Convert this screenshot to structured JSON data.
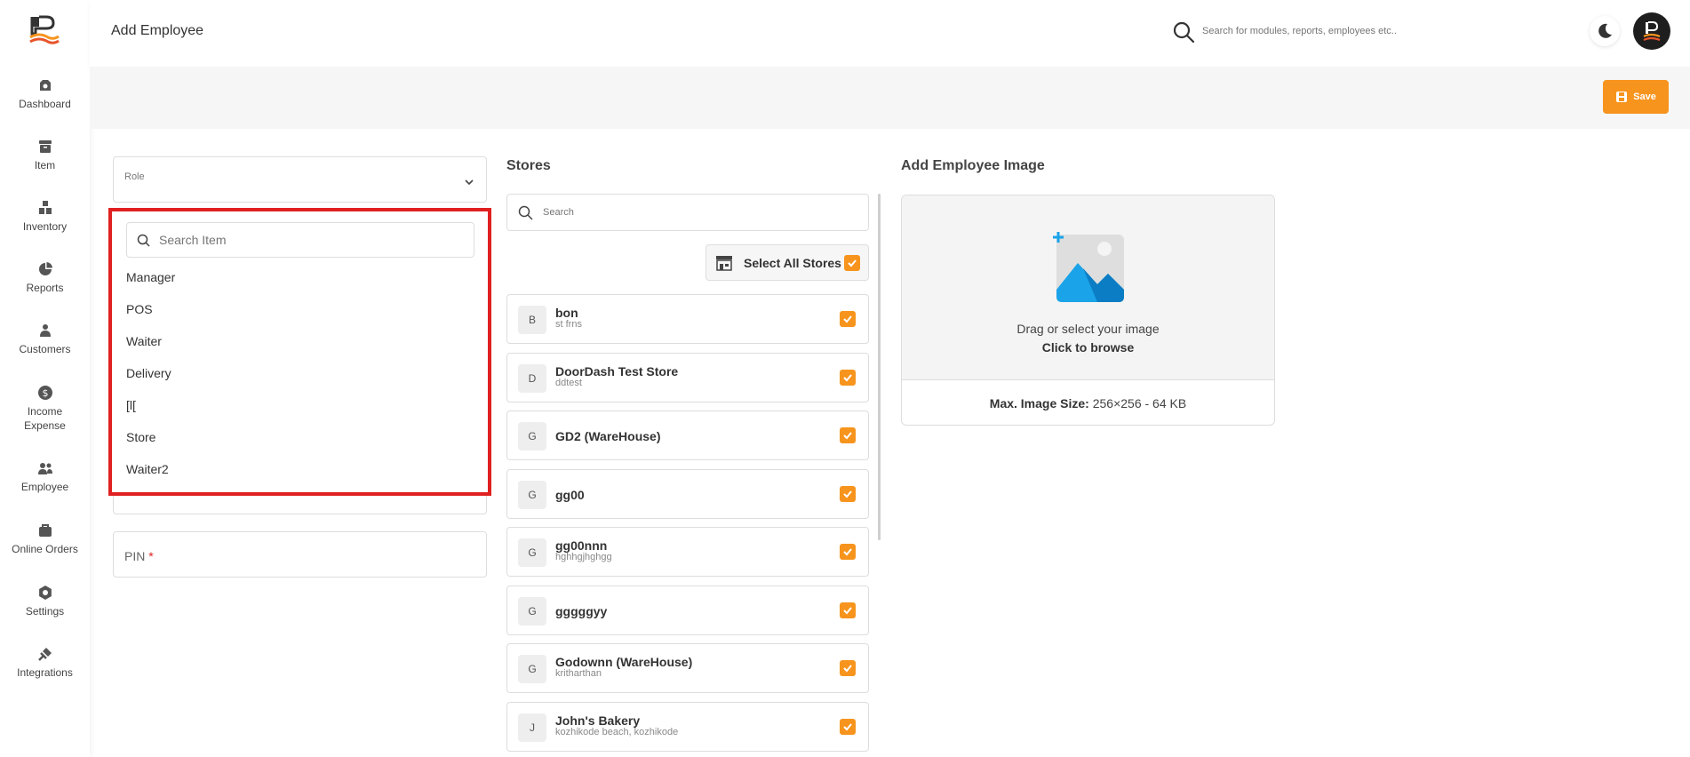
{
  "sidebar": {
    "items": [
      {
        "label": "Dashboard",
        "icon": "dashboard-icon"
      },
      {
        "label": "Item",
        "icon": "item-box-icon"
      },
      {
        "label": "Inventory",
        "icon": "inventory-icon"
      },
      {
        "label": "Reports",
        "icon": "pie-chart-icon"
      },
      {
        "label": "Customers",
        "icon": "customers-icon"
      },
      {
        "label": "Income\nExpense",
        "icon": "dollar-icon"
      },
      {
        "label": "Employee",
        "icon": "employee-icon"
      },
      {
        "label": "Online Orders",
        "icon": "bag-icon"
      },
      {
        "label": "Settings",
        "icon": "gear-icon"
      },
      {
        "label": "Integrations",
        "icon": "plug-icon"
      }
    ]
  },
  "header": {
    "title": "Add Employee",
    "search_placeholder": "Search for modules, reports, employees etc.."
  },
  "toolbar": {
    "save_label": "Save"
  },
  "form": {
    "role_label": "Role",
    "dropdown": {
      "search_placeholder": "Search Item",
      "options": [
        "Manager",
        "POS",
        "Waiter",
        "Delivery",
        "[l[",
        "Store",
        "Waiter2"
      ]
    },
    "pin_label": "PIN",
    "pin_required": "*"
  },
  "stores": {
    "title": "Stores",
    "search_placeholder": "Search",
    "select_all_label": "Select All Stores",
    "items": [
      {
        "letter": "B",
        "name": "bon",
        "sub": "st frns"
      },
      {
        "letter": "D",
        "name": "DoorDash Test Store",
        "sub": "ddtest"
      },
      {
        "letter": "G",
        "name": "GD2 (WareHouse)",
        "sub": ""
      },
      {
        "letter": "G",
        "name": "gg00",
        "sub": ""
      },
      {
        "letter": "G",
        "name": "gg00nnn",
        "sub": "hghhgjhghgg"
      },
      {
        "letter": "G",
        "name": "gggggyy",
        "sub": ""
      },
      {
        "letter": "G",
        "name": "Godownn (WareHouse)",
        "sub": "kritharthan"
      },
      {
        "letter": "J",
        "name": "John's Bakery",
        "sub": "kozhikode beach, kozhikode"
      }
    ]
  },
  "image_upload": {
    "title": "Add Employee Image",
    "drag_text": "Drag or select your image",
    "browse_text": "Click to browse",
    "size_label": "Max. Image Size:",
    "size_value": "256×256 - 64 KB"
  },
  "colors": {
    "accent": "#f7941d",
    "highlight_border": "#e02020"
  }
}
